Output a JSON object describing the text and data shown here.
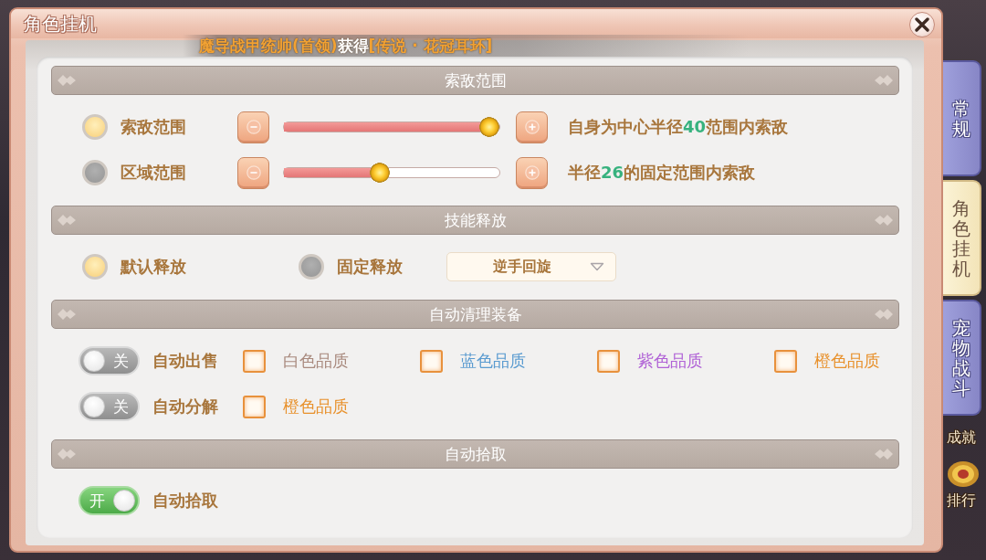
{
  "window": {
    "title": "角色挂机"
  },
  "broadcast": [
    {
      "kind": "name",
      "text": "魔导战甲统帅(首领)"
    },
    {
      "kind": "plain",
      "text": "获得"
    },
    {
      "kind": "item",
      "text": "[传说 · 花冠耳环]"
    }
  ],
  "sections": [
    {
      "title": "索敌范围",
      "rows": [
        {
          "items": [
            {
              "kind": "radio",
              "label": "索敌范围",
              "selected": true
            },
            {
              "kind": "slider",
              "level": 1
            },
            {
              "kind": "note",
              "text": "自身为中心半径**40**范围内索敌"
            }
          ]
        },
        {
          "items": [
            {
              "kind": "radio",
              "label": "区域范围",
              "selected": false
            },
            {
              "kind": "slider",
              "level": 0.49
            },
            {
              "kind": "note",
              "text": "半径**26**的固定范围内索敌"
            }
          ]
        }
      ]
    },
    {
      "title": "技能释放",
      "rows": [
        {
          "items": [
            {
              "kind": "radio",
              "label": "默认释放",
              "selected": true
            },
            {
              "kind": "radio",
              "label": "固定释放",
              "selected": false
            },
            {
              "kind": "dropdown",
              "value": "逆手回旋"
            }
          ]
        }
      ]
    },
    {
      "title": "自动清理装备",
      "rows": [
        {
          "items": [
            {
              "kind": "toggle",
              "on": false,
              "text": "关",
              "label": "自动出售"
            },
            {
              "kind": "checkbox",
              "label": "白色品质",
              "checked": false,
              "color": "#a98a7e"
            },
            {
              "kind": "checkbox",
              "label": "蓝色品质",
              "checked": false,
              "color": "#5a9bd0"
            },
            {
              "kind": "checkbox",
              "label": "紫色品质",
              "checked": false,
              "color": "#b062d6"
            },
            {
              "kind": "checkbox",
              "label": "橙色品质",
              "checked": false,
              "color": "#e8912c"
            }
          ]
        },
        {
          "items": [
            {
              "kind": "toggle",
              "on": false,
              "text": "关",
              "label": "自动分解"
            },
            {
              "kind": "checkbox",
              "label": "橙色品质",
              "checked": false,
              "color": "#e8912c"
            }
          ]
        }
      ]
    },
    {
      "title": "自动拾取",
      "rows": [
        {
          "items": [
            {
              "kind": "toggle",
              "on": true,
              "text": "开",
              "label": "自动拾取"
            }
          ]
        }
      ]
    }
  ],
  "tabs": [
    {
      "label": "常规",
      "selected": false
    },
    {
      "label": "角色挂机",
      "selected": true
    },
    {
      "label": "宠物战斗",
      "selected": false
    }
  ],
  "side_menu": [
    {
      "label": "成就"
    },
    {
      "label": "排行"
    }
  ]
}
